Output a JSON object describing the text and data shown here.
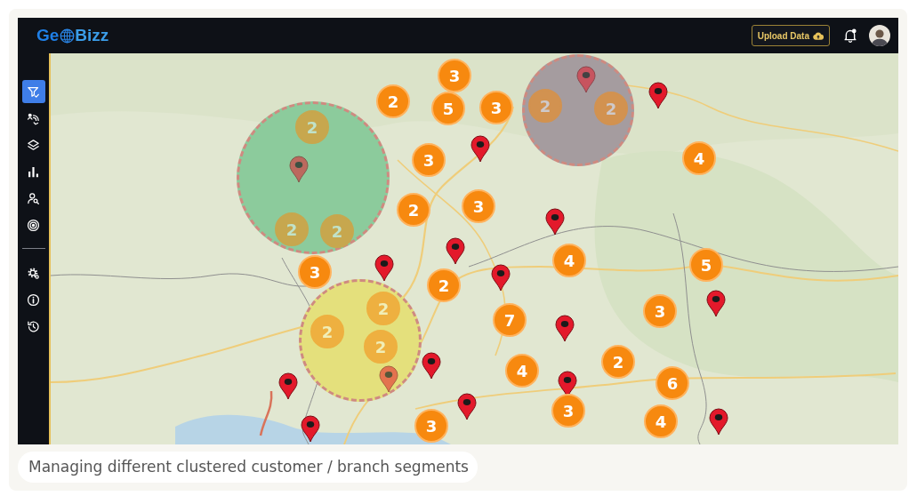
{
  "header": {
    "logo": {
      "start": "Ge",
      "end": "Bizz"
    },
    "upload_button": {
      "label": "Upload Data"
    }
  },
  "sidebar": {
    "items": [
      {
        "selected": true
      },
      {
        "selected": false
      },
      {
        "selected": false
      },
      {
        "selected": false
      },
      {
        "selected": false
      },
      {
        "selected": false
      }
    ],
    "bottom_items": [
      {
        "selected": false
      },
      {
        "selected": false
      },
      {
        "selected": false
      }
    ]
  },
  "map": {
    "segments": [
      {
        "color": "#8ccb9c",
        "clusters": [
          {
            "count": "2"
          },
          {
            "count": "2"
          },
          {
            "count": "2"
          }
        ]
      },
      {
        "color": "#a59c9f",
        "clusters": [
          {
            "count": "2"
          },
          {
            "count": "2"
          }
        ]
      },
      {
        "color": "#e4e07c",
        "clusters": [
          {
            "count": "2"
          },
          {
            "count": "2"
          },
          {
            "count": "2"
          }
        ]
      }
    ],
    "clusters": [
      {
        "count": "3"
      },
      {
        "count": "2"
      },
      {
        "count": "5"
      },
      {
        "count": "3"
      },
      {
        "count": "3"
      },
      {
        "count": "4"
      },
      {
        "count": "2"
      },
      {
        "count": "3"
      },
      {
        "count": "4"
      },
      {
        "count": "5"
      },
      {
        "count": "3"
      },
      {
        "count": "2"
      },
      {
        "count": "3"
      },
      {
        "count": "7"
      },
      {
        "count": "2"
      },
      {
        "count": "4"
      },
      {
        "count": "6"
      },
      {
        "count": "3"
      },
      {
        "count": "4"
      },
      {
        "count": "3"
      }
    ]
  },
  "caption": "Managing different clustered customer / branch segments"
}
